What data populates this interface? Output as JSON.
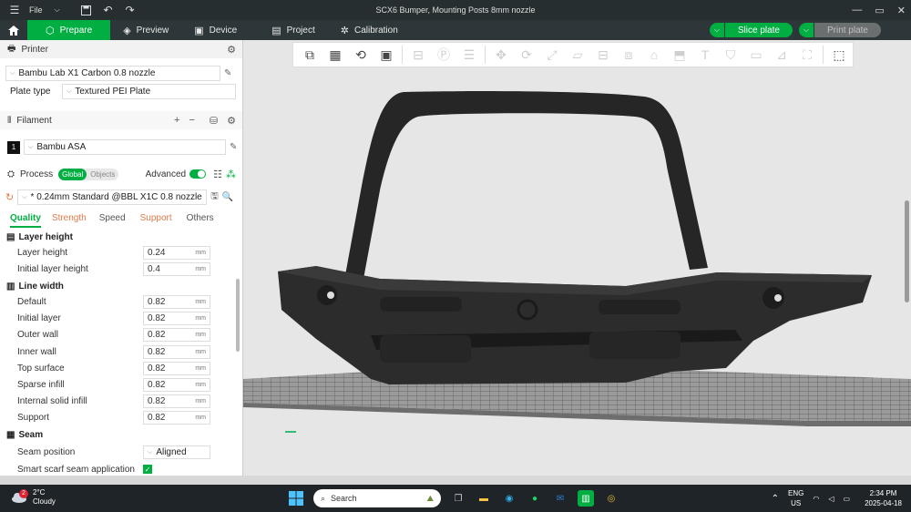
{
  "window": {
    "title": "SCX6 Bumper, Mounting Posts 8mm nozzle",
    "file_menu": "File"
  },
  "tabs": [
    {
      "label": "Prepare",
      "icon": "cube-icon"
    },
    {
      "label": "Preview",
      "icon": "layers-icon"
    },
    {
      "label": "Device",
      "icon": "monitor-icon"
    },
    {
      "label": "Project",
      "icon": "project-icon"
    },
    {
      "label": "Calibration",
      "icon": "calibration-icon"
    }
  ],
  "actions": {
    "slice": "Slice plate",
    "print": "Print plate"
  },
  "printer": {
    "heading": "Printer",
    "name": "Bambu Lab X1 Carbon 0.8 nozzle",
    "plate_type_label": "Plate type",
    "plate_type": "Textured PEI Plate"
  },
  "filament": {
    "heading": "Filament",
    "slot": "1",
    "name": "Bambu ASA"
  },
  "process": {
    "heading": "Process",
    "scope": [
      "Global",
      "Objects"
    ],
    "advanced_label": "Advanced",
    "preset": "* 0.24mm Standard @BBL X1C 0.8 nozzle"
  },
  "quality_tabs": [
    "Quality",
    "Strength",
    "Speed",
    "Support",
    "Others"
  ],
  "groups": {
    "layer_height": {
      "title": "Layer height",
      "params": [
        {
          "label": "Layer height",
          "value": "0.24",
          "unit": "mm"
        },
        {
          "label": "Initial layer height",
          "value": "0.4",
          "unit": "mm"
        }
      ]
    },
    "line_width": {
      "title": "Line width",
      "params": [
        {
          "label": "Default",
          "value": "0.82",
          "unit": "mm"
        },
        {
          "label": "Initial layer",
          "value": "0.82",
          "unit": "mm"
        },
        {
          "label": "Outer wall",
          "value": "0.82",
          "unit": "mm"
        },
        {
          "label": "Inner wall",
          "value": "0.82",
          "unit": "mm"
        },
        {
          "label": "Top surface",
          "value": "0.82",
          "unit": "mm"
        },
        {
          "label": "Sparse infill",
          "value": "0.82",
          "unit": "mm"
        },
        {
          "label": "Internal solid infill",
          "value": "0.82",
          "unit": "mm"
        },
        {
          "label": "Support",
          "value": "0.82",
          "unit": "mm"
        }
      ]
    },
    "seam": {
      "title": "Seam",
      "seam_position_label": "Seam position",
      "seam_position": "Aligned",
      "scarf_label": "Smart scarf seam application"
    }
  },
  "taskbar": {
    "weather_temp": "2°C",
    "weather_desc": "Cloudy",
    "weather_badge": "2",
    "search": "Search",
    "lang": "ENG",
    "region": "US",
    "time": "2:34 PM",
    "date": "2025-04-18"
  }
}
